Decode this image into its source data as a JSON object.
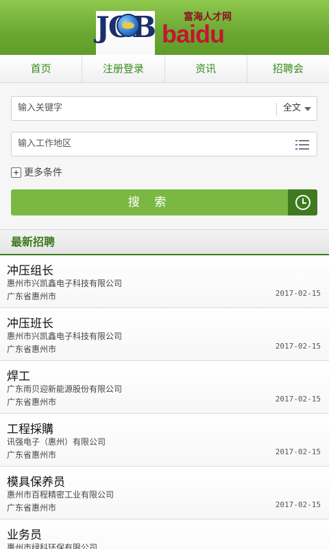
{
  "header": {
    "logo_job": "JOB",
    "logo_baidu": "baidu",
    "logo_tagline": "富海人才网"
  },
  "nav": [
    {
      "label": "首页"
    },
    {
      "label": "注册登录"
    },
    {
      "label": "资讯"
    },
    {
      "label": "招聘会"
    }
  ],
  "search": {
    "keyword_placeholder": "输入关键字",
    "scope_selected": "全文",
    "area_placeholder": "输入工作地区",
    "more_conditions_label": "更多条件",
    "search_button_label": "搜 索"
  },
  "latest": {
    "section_title": "最新招聘",
    "jobs": [
      {
        "title": "冲压组长",
        "company": "惠州市兴凯鑫电子科技有限公司",
        "location": "广东省惠州市",
        "date": "2017-02-15"
      },
      {
        "title": "冲压班长",
        "company": "惠州市兴凯鑫电子科技有限公司",
        "location": "广东省惠州市",
        "date": "2017-02-15"
      },
      {
        "title": "焊工",
        "company": "广东雨贝迎新能源股份有限公司",
        "location": "广东省惠州市",
        "date": "2017-02-15"
      },
      {
        "title": "工程採購",
        "company": "讯强电子（惠州）有限公司",
        "location": "广东省惠州市",
        "date": "2017-02-15"
      },
      {
        "title": "模具保养员",
        "company": "惠州市百程精密工业有限公司",
        "location": "广东省惠州市",
        "date": "2017-02-15"
      },
      {
        "title": "业务员",
        "company": "惠州市绿科环保有限公司",
        "location": "",
        "date": ""
      }
    ]
  },
  "colors": {
    "brand_green": "#6aa832",
    "button_green": "#7bb843",
    "dark_green": "#3f7a1f",
    "logo_red": "#c3162e",
    "logo_navy": "#1a2f6b"
  },
  "icons": [
    "globe-logo-icon",
    "chevron-down-icon",
    "list-icon",
    "plus-icon",
    "clock-icon"
  ]
}
